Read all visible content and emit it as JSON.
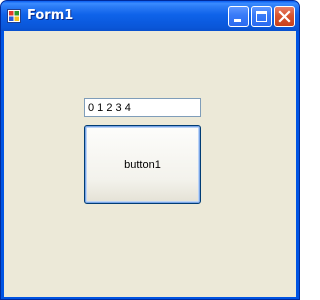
{
  "window": {
    "title": "Form1",
    "icon": "form-app-icon",
    "caption_buttons": [
      "minimize-icon",
      "maximize-icon",
      "close-icon"
    ]
  },
  "form": {
    "textbox_value": "0 1 2 3 4",
    "button_label": "button1"
  },
  "colors": {
    "titlebar": "#0a5ce0",
    "client_background": "#ece9d8",
    "close_button": "#d7552f",
    "textbox_border": "#7f9db9",
    "button_border": "#003c74"
  }
}
